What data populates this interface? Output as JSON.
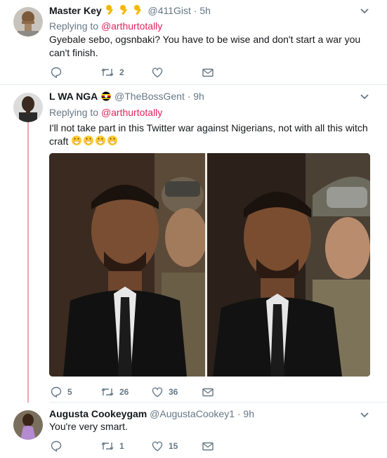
{
  "tweets": [
    {
      "name": "Master Key",
      "emoji_badges": "🔑🔑🔑",
      "handle": "@411Gist",
      "time": "· 5h",
      "replying_prefix": "Replying to ",
      "replying_to": "@arthurtotally",
      "text": "Gyebale sebo, ogsnbaki? You have to be wise and don't start a war you can't finish.",
      "replies": "",
      "retweets": "2",
      "likes": ""
    },
    {
      "name": "L WA NGA",
      "flag": "🇺🇬",
      "handle": "@TheBossGent",
      "time": "· 9h",
      "replying_prefix": "Replying to ",
      "replying_to": "@arthurtotally",
      "text": "I'll  not take part in this Twitter  war against  Nigerians, not with all this witch craft",
      "text_emoji": "😁😁😁😁",
      "replies": "5",
      "retweets": "26",
      "likes": "36"
    },
    {
      "name": "Augusta Cookeygam",
      "handle": "@AugustaCookey1",
      "time": "· 9h",
      "text": "You're very smart.",
      "replies": "",
      "retweets": "1",
      "likes": "15"
    }
  ],
  "colors": {
    "link": "#e0245e",
    "muted": "#657786",
    "thread": "#f4a1ae"
  }
}
